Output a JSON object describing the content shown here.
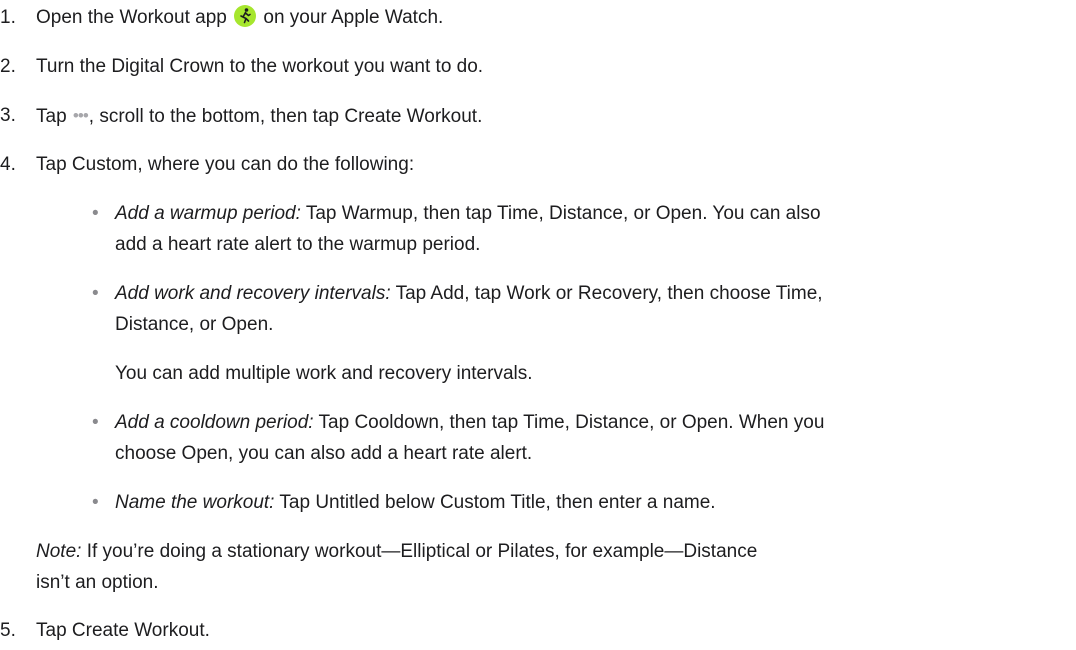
{
  "steps": [
    {
      "number": "1.",
      "before": "Open the Workout app",
      "icon": "workout-app-icon",
      "after": "on your Apple Watch."
    },
    {
      "number": "2.",
      "text": "Turn the Digital Crown to the workout you want to do."
    },
    {
      "number": "3.",
      "before": "Tap",
      "icon": "more-dots-icon",
      "after": ", scroll to the bottom, then tap Create Workout."
    },
    {
      "number": "4.",
      "text": "Tap Custom, where you can do the following:",
      "bullets": [
        {
          "lead": "Add a warmup period:",
          "lines": [
            "Tap Warmup, then tap Time, Distance, or Open. You can also",
            "add a heart rate alert to the warmup period."
          ]
        },
        {
          "lead": "Add work and recovery intervals:",
          "lines": [
            "Tap Add, tap Work or Recovery, then choose Time,",
            "Distance, or Open."
          ],
          "extra": "You can add multiple work and recovery intervals."
        },
        {
          "lead": "Add a cooldown period:",
          "lines": [
            "Tap Cooldown, then tap Time, Distance, or Open. When you",
            "choose Open, you can also add a heart rate alert."
          ]
        },
        {
          "lead": "Name the workout:",
          "lines": [
            "Tap Untitled below Custom Title, then enter a name."
          ]
        }
      ],
      "note": {
        "lead": "Note:",
        "lines": [
          "If you’re doing a stationary workout—Elliptical or Pilates, for example—Distance",
          "isn’t an option."
        ]
      }
    },
    {
      "number": "5.",
      "text": "Tap Create Workout."
    }
  ],
  "bullet_glyph": "•",
  "dots_glyph": "•••",
  "colors": {
    "text": "#1d1d1f",
    "icon_green": "#a6e62e",
    "dots_gray": "#a7a7ab"
  }
}
